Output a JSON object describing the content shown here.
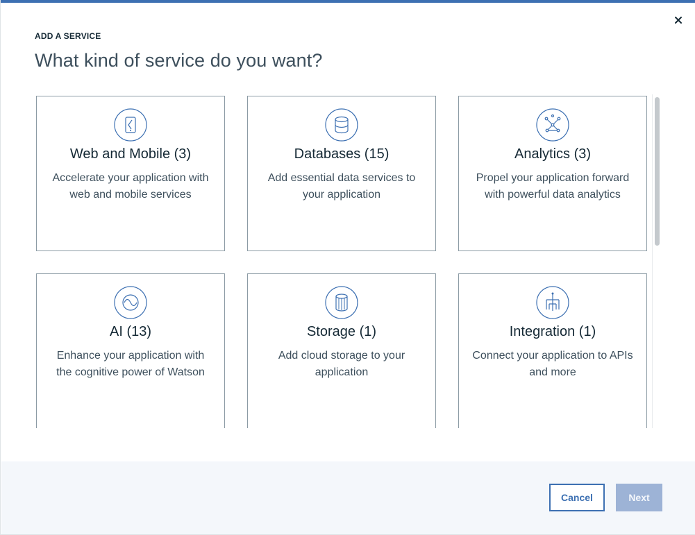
{
  "modal": {
    "label": "ADD A SERVICE",
    "title": "What kind of service do you want?"
  },
  "cards": [
    {
      "title": "Web and Mobile (3)",
      "description": "Accelerate your application with web and mobile services",
      "icon": "mobile-icon"
    },
    {
      "title": "Databases (15)",
      "description": "Add essential data services to your application",
      "icon": "database-icon"
    },
    {
      "title": "Analytics (3)",
      "description": "Propel your application forward with powerful data analytics",
      "icon": "analytics-icon"
    },
    {
      "title": "AI (13)",
      "description": "Enhance your application with the cognitive power of Watson",
      "icon": "ai-icon"
    },
    {
      "title": "Storage (1)",
      "description": "Add cloud storage to your application",
      "icon": "storage-icon"
    },
    {
      "title": "Integration (1)",
      "description": "Connect your application to APIs and more",
      "icon": "integration-icon"
    }
  ],
  "footer": {
    "cancel_label": "Cancel",
    "next_label": "Next"
  },
  "colors": {
    "accent": "#3d70b2",
    "disabled_button": "#9db3d6",
    "card_border": "#8c9ba5",
    "footer_bg": "#f4f7fb"
  }
}
